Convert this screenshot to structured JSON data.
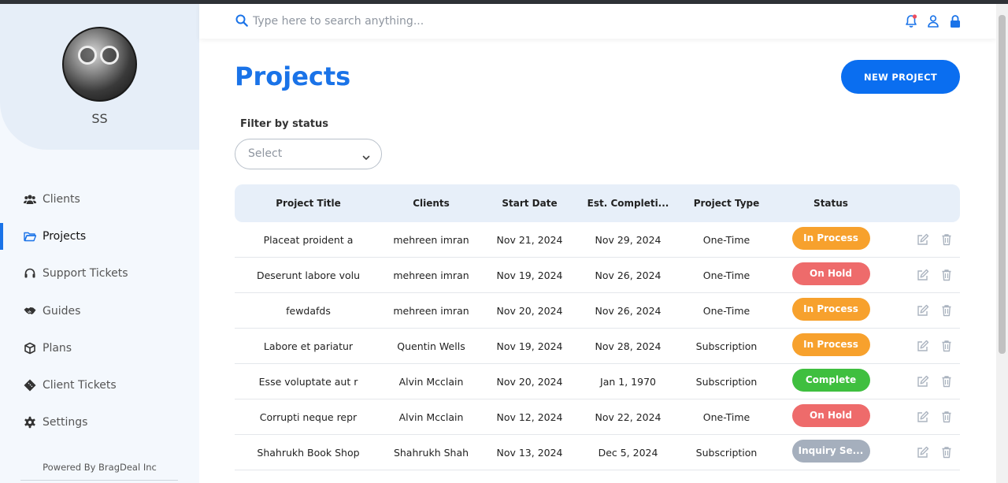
{
  "sidebar": {
    "user_initials": "SS",
    "items": [
      {
        "label": "Clients",
        "icon": "users-icon"
      },
      {
        "label": "Projects",
        "icon": "folder-icon"
      },
      {
        "label": "Support Tickets",
        "icon": "headset-icon"
      },
      {
        "label": "Guides",
        "icon": "handshake-icon"
      },
      {
        "label": "Plans",
        "icon": "box-icon"
      },
      {
        "label": "Client Tickets",
        "icon": "ticket-icon"
      },
      {
        "label": "Settings",
        "icon": "gear-icon"
      }
    ],
    "active_item": "Projects",
    "footer": "Powered By BragDeal Inc"
  },
  "search": {
    "placeholder": "Type here to search anything..."
  },
  "header_icons": [
    "bell-icon",
    "user-icon",
    "lock-icon"
  ],
  "main": {
    "title": "Projects",
    "new_button": "NEW PROJECT",
    "filter_label": "Filter by status",
    "filter_select": "Select"
  },
  "table": {
    "columns": [
      "Project Title",
      "Clients",
      "Start Date",
      "Est. Completi...",
      "Project Type",
      "Status"
    ],
    "rows": [
      [
        "Placeat proident a",
        "mehreen imran",
        "Nov 21, 2024",
        "Nov 29, 2024",
        "One-Time",
        "In Process"
      ],
      [
        "Deserunt labore volu",
        "mehreen imran",
        "Nov 19, 2024",
        "Nov 26, 2024",
        "One-Time",
        "On Hold"
      ],
      [
        "fewdafds",
        "mehreen imran",
        "Nov 20, 2024",
        "Nov 26, 2024",
        "One-Time",
        "In Process"
      ],
      [
        "Labore et pariatur",
        "Quentin Wells",
        "Nov 19, 2024",
        "Nov 28, 2024",
        "Subscription",
        "In Process"
      ],
      [
        "Esse voluptate aut r",
        "Alvin Mcclain",
        "Nov 20, 2024",
        "Jan 1, 1970",
        "Subscription",
        "Complete"
      ],
      [
        "Corrupti neque repr",
        "Alvin Mcclain",
        "Nov 12, 2024",
        "Nov 22, 2024",
        "One-Time",
        "On Hold"
      ],
      [
        "Shahrukh Book Shop",
        "Shahrukh Shah",
        "Nov 13, 2024",
        "Dec 5, 2024",
        "Subscription",
        "Inquiry Se..."
      ]
    ]
  },
  "status_colors": {
    "In Process": "#f7a12d",
    "On Hold": "#ee6b6b",
    "Complete": "#3fbf3f",
    "Inquiry Se...": "#a5afbd"
  },
  "colors": {
    "accent": "#1a73e8",
    "button": "#0a6ef0"
  }
}
